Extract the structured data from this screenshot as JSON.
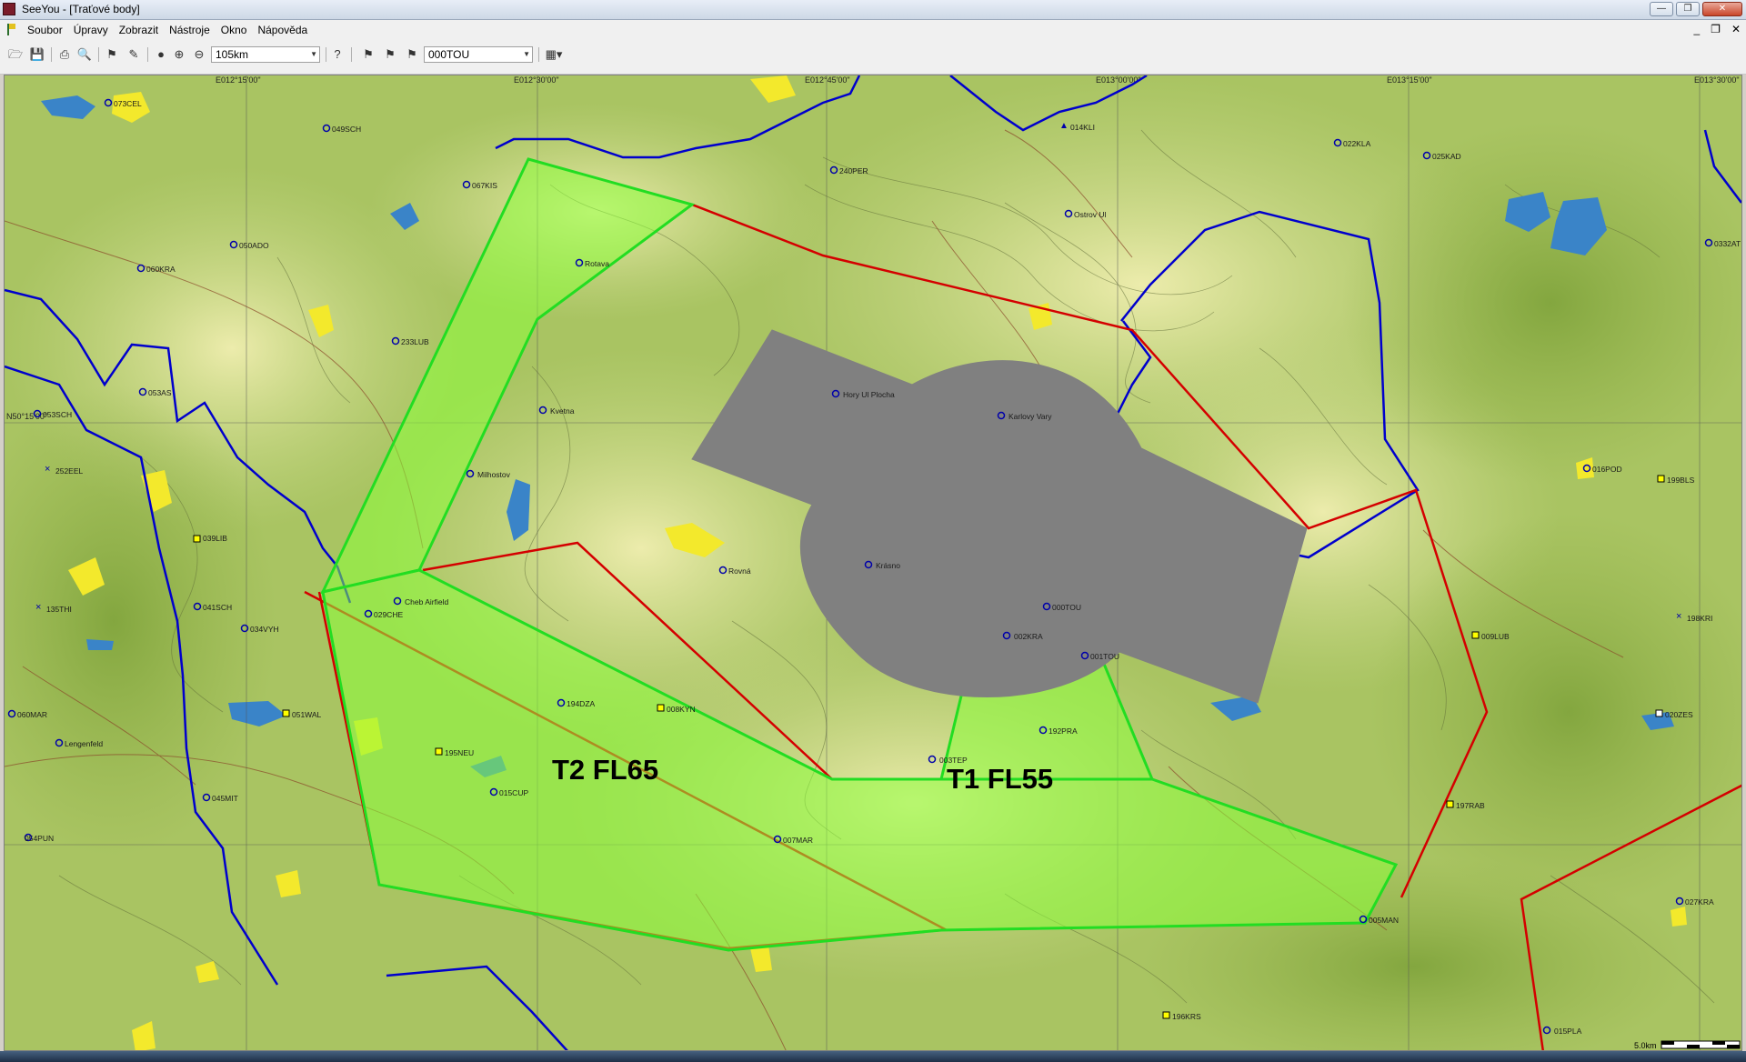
{
  "window": {
    "title": "SeeYou - [Traťové body]",
    "controls": [
      "—",
      "❐",
      "✕"
    ]
  },
  "menu": {
    "items": [
      "Soubor",
      "Úpravy",
      "Zobrazit",
      "Nástroje",
      "Okno",
      "Nápověda"
    ],
    "mdi_controls": [
      "_",
      "❐",
      "✕"
    ]
  },
  "toolbar": {
    "zoom_value": "105km",
    "waypoint_value": "000TOU"
  },
  "map": {
    "colors": {
      "terrain_low": "#9fbb4f",
      "terrain_high": "#e9e7a2",
      "task_area": "#8cff3c",
      "task_border": "#22dd22",
      "red_line": "#d40000",
      "blue_border": "#0000cc",
      "restricted": "#808080",
      "grid": "#555555"
    },
    "grid_labels": {
      "lon": [
        "E012°15'00\"",
        "E012°30'00\"",
        "E012°45'00\"",
        "E013°00'00\"",
        "E013°15'00\"",
        "E013°30'00\""
      ],
      "lat": [
        "N50°15'00\""
      ]
    },
    "task_labels": {
      "t2": "T2  FL65",
      "t1": "T1  FL55"
    },
    "scale_label": "5.0km",
    "waypoints": [
      "073CEL",
      "049SCH",
      "067KIS",
      "050ADO",
      "060KRA",
      "233LUB",
      "053AS",
      "053SCH",
      "252EEL",
      "039LIB",
      "135THI",
      "041SCH",
      "034VYH",
      "029CHE",
      "Cheb Airfield",
      "060MAR",
      "051WAL",
      "Lengenfeld",
      "195NEU",
      "045MIT",
      "054PUN",
      "015CUP",
      "007MAR",
      "Rotava",
      "Kvetna",
      "Milhostov",
      "194DZA",
      "008KYN",
      "Rovná",
      "Krásno",
      "003TEP",
      "240PER",
      "014KLI",
      "Ostrov Ul",
      "022KLA",
      "025KAD",
      "0332AT",
      "Hory Ul Plocha",
      "Karlovy Vary",
      "000TOU",
      "002KRA",
      "001TOU",
      "192PRA",
      "005MAN",
      "196KRS",
      "016POD",
      "199BLS",
      "009LUB",
      "198KRI",
      "020ZES",
      "197RAB",
      "027KRA",
      "015PLA"
    ]
  }
}
